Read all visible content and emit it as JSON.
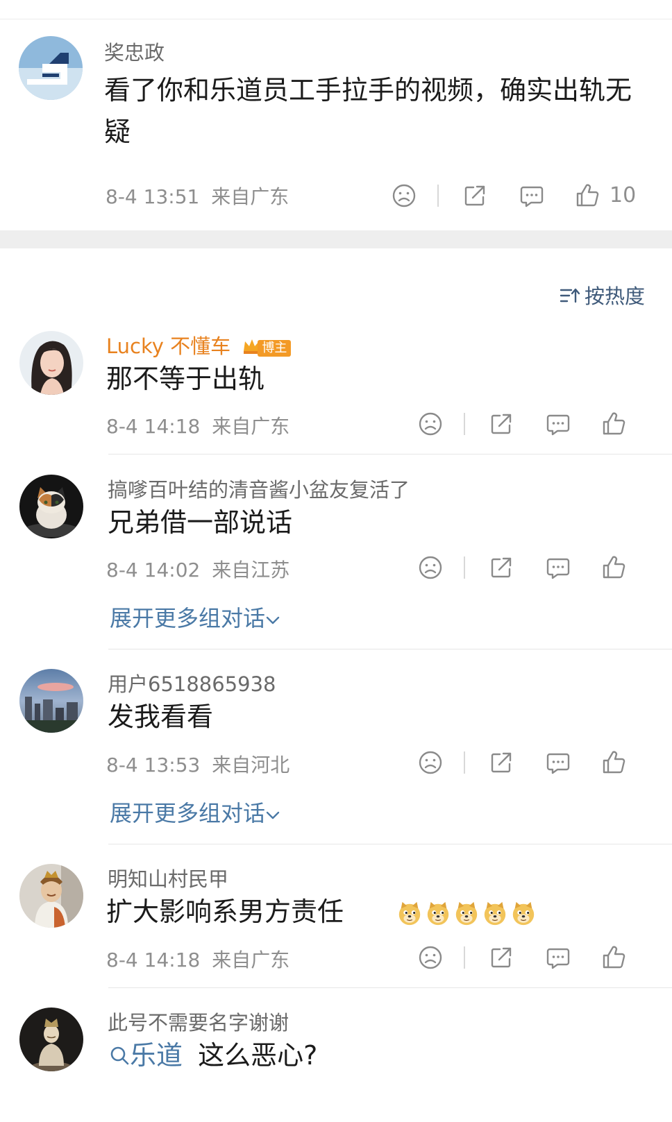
{
  "post": {
    "author": "奖忠政",
    "text": "看了你和乐道员工手拉手的视频，确实出轨无疑",
    "time": "8-4 13:51",
    "location": "来自广东",
    "like_count": "10"
  },
  "sort_label": "按热度",
  "comments": [
    {
      "author": "Lucky 不懂车",
      "badge": "博主",
      "text": "那不等于出轨",
      "time": "8-4 14:18",
      "location": "来自广东"
    },
    {
      "author": "搞嗲百叶结的清音酱小盆友复活了",
      "text": "兄弟借一部说话",
      "time": "8-4 14:02",
      "location": "来自江苏",
      "expand": "展开更多组对话"
    },
    {
      "author": "用户6518865938",
      "text": "发我看看",
      "time": "8-4 13:53",
      "location": "来自河北",
      "expand": "展开更多组对话"
    },
    {
      "author": "明知山村民甲",
      "text": "扩大影响系男方责任",
      "time": "8-4 14:18",
      "location": "来自广东"
    },
    {
      "author": "此号不需要名字谢谢",
      "link_text": "乐道",
      "text": "这么恶心?"
    }
  ],
  "icons": {
    "dislike": "sad-face-icon",
    "share": "share-icon",
    "comment": "comment-icon",
    "like": "thumbs-up-icon",
    "sort": "sort-icon",
    "search": "search-icon",
    "doge": "doge-emoji-icon"
  },
  "colors": {
    "accent_blue": "#4a79a6",
    "vip_orange": "#e8821f",
    "meta_gray": "#8e8e8e"
  }
}
